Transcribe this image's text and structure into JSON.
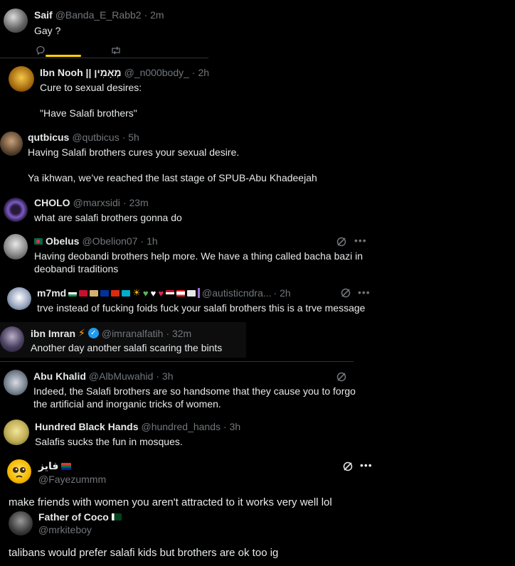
{
  "posts": [
    {
      "name": "Saif",
      "handle": "@Banda_E_Rabb2",
      "time": "· 2m",
      "text": "Gay ?"
    },
    {
      "name": "Ibn Nooh || מְאָמִין",
      "handle": "@_n000body_",
      "time": "· 2h",
      "line1": "Cure to sexual desires:",
      "line2": "\"Have Salafi brothers\""
    },
    {
      "name": "qutbicus",
      "handle": "@qutbicus",
      "time": "· 5h",
      "line1": "Having Salafi brothers cures your sexual desire.",
      "line2": "Ya ikhwan, we’ve reached the last stage of SPUB-Abu Khadeejah"
    },
    {
      "name": "CHOLO",
      "handle": "@marxsidi",
      "time": "· 23m",
      "text": "what are salafi brothers gonna do"
    },
    {
      "name": "Obelus",
      "handle": "@Obelion07",
      "time": "· 1h",
      "line1": "Having deobandi brothers help more. We have a thing called bacha bazi in",
      "line2": "deobandi traditions"
    },
    {
      "name": "m7md",
      "handle": "@autisticndra...",
      "time": "· 2h",
      "text": "trve instead of fucking foids fuck your salafi brothers this is a trve message"
    },
    {
      "name": "ibn Imran",
      "handle": "@imranalfatih",
      "time": "· 32m",
      "text": "Another day another salafi scaring the bints"
    },
    {
      "name": "Abu Khalid",
      "handle": "@AlbMuwahid",
      "time": "· 3h",
      "line1": "Indeed, the Salafi brothers are so handsome that they cause you to forgo",
      "line2": "the artificial and inorganic tricks of women."
    },
    {
      "name": "Hundred Black Hands",
      "handle": "@hundred_hands",
      "time": "· 3h",
      "text": "Salafis sucks the fun in mosques."
    },
    {
      "name": "فايز",
      "handle": "@Fayezummm",
      "text": "make friends with women you aren't attracted to it works very well lol"
    },
    {
      "name": "Father of Coco",
      "handle": "@mrkiteboy",
      "text": "talibans would prefer salafi kids but brothers are ok too ig"
    }
  ],
  "icons": {
    "reply": "reply-icon",
    "repost": "repost-icon",
    "more": "more-icon",
    "grok": "grok-icon",
    "verified": "verified-badge-icon"
  },
  "colors": {
    "bg": "#000000",
    "text": "#e7e9ea",
    "muted": "#71767b",
    "accent": "#ffd400",
    "verified": "#1d9bf0"
  }
}
